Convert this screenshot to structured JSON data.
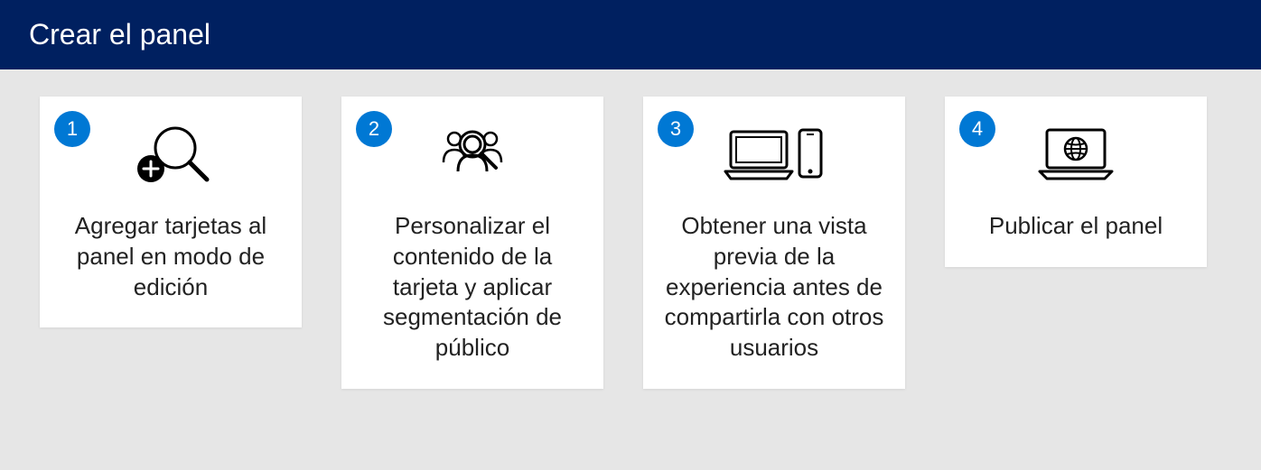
{
  "header": {
    "title": "Crear el panel"
  },
  "steps": [
    {
      "number": "1",
      "icon": "add-magnify-icon",
      "text": "Agregar tarjetas al panel en modo de edición"
    },
    {
      "number": "2",
      "icon": "audience-magnify-icon",
      "text": "Personalizar el contenido de la tarjeta y aplicar segmentación de público"
    },
    {
      "number": "3",
      "icon": "laptop-mobile-icon",
      "text": "Obtener una vista previa de la experiencia antes de compartirla con otros usuarios"
    },
    {
      "number": "4",
      "icon": "laptop-globe-icon",
      "text": "Publicar el panel"
    }
  ]
}
